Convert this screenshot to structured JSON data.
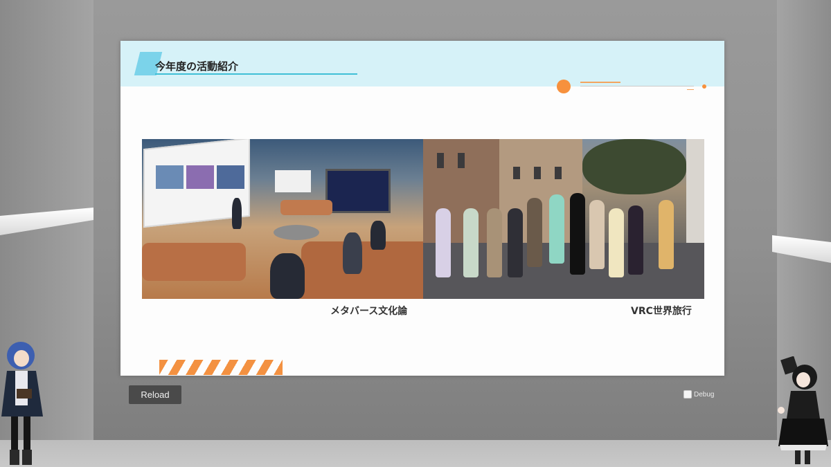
{
  "slide": {
    "title": "今年度の活動紹介",
    "photos": [
      {
        "caption": "メタバース文化論"
      },
      {
        "caption": "VRC世界旅行"
      }
    ]
  },
  "controls": {
    "reload_label": "Reload",
    "debug_label": "Debug",
    "debug_checked": false
  },
  "colors": {
    "accent_orange": "#f7913d",
    "header_cyan": "#d6f2f8",
    "title_bar": "#7bd3ea"
  }
}
